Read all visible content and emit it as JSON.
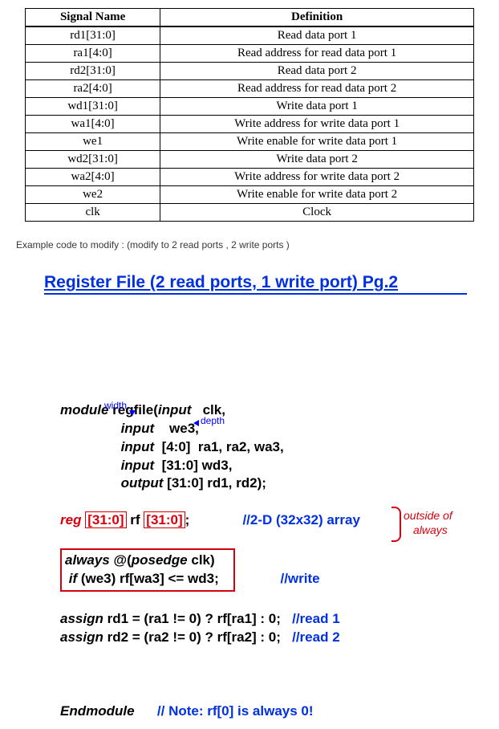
{
  "table": {
    "headers": [
      "Signal Name",
      "Definition"
    ],
    "rows": [
      {
        "name": "rd1[31:0]",
        "def": "Read data port 1"
      },
      {
        "name": "ra1[4:0]",
        "def": "Read address for read data port 1"
      },
      {
        "name": "rd2[31:0]",
        "def": "Read data port 2"
      },
      {
        "name": "ra2[4:0]",
        "def": "Read address for read data port 2"
      },
      {
        "name": "wd1[31:0]",
        "def": "Write data port 1"
      },
      {
        "name": "wa1[4:0]",
        "def": "Write address for write data port 1"
      },
      {
        "name": "we1",
        "def": "Write enable for write data port 1"
      },
      {
        "name": "wd2[31:0]",
        "def": "Write data port 2"
      },
      {
        "name": "wa2[4:0]",
        "def": "Write address for write data port 2"
      },
      {
        "name": "we2",
        "def": "Write enable for write data port 2"
      },
      {
        "name": "clk",
        "def": "Clock"
      }
    ]
  },
  "example_note": "Example code to modify : (modify to 2 read ports , 2 write ports )",
  "slide_title": "Register File (2 read ports, 1 write port) Pg.2",
  "annot": {
    "width": "width",
    "depth": "depth",
    "outside": "outside of",
    "always": "always"
  },
  "code": {
    "module": "module",
    "regfile": " regfile(",
    "input": "input",
    "output": "output",
    "clk": "   clk,",
    "we3": "    we3,",
    "r5": "  [4:0]  ra1, ra2, wa3,",
    "r32": "  [31:0] wd3,",
    "o32": " [31:0] rd1, rd2);",
    "reg": "reg",
    "idx1": "[31:0]",
    "rf": " rf ",
    "idx2": "[31:0]",
    "semi": ";",
    "arr": "//2-D (32x32) array",
    "always": "always",
    "at": " @(",
    "posedge": "posedge",
    "clkp": " clk)",
    "if": "if",
    "body": " (we3) rf[wa3] <= wd3;",
    "write": "//write",
    "assign": "assign",
    "rd1": " rd1 = (ra1 != 0) ? rf[ra1] : 0;   ",
    "read1": "//read 1",
    "rd2": " rd2 = (ra2 != 0) ? rf[ra2] : 0;   ",
    "read2": "//read 2",
    "end": "Endmodule",
    "note": "// Note: rf[0] is always 0!"
  }
}
